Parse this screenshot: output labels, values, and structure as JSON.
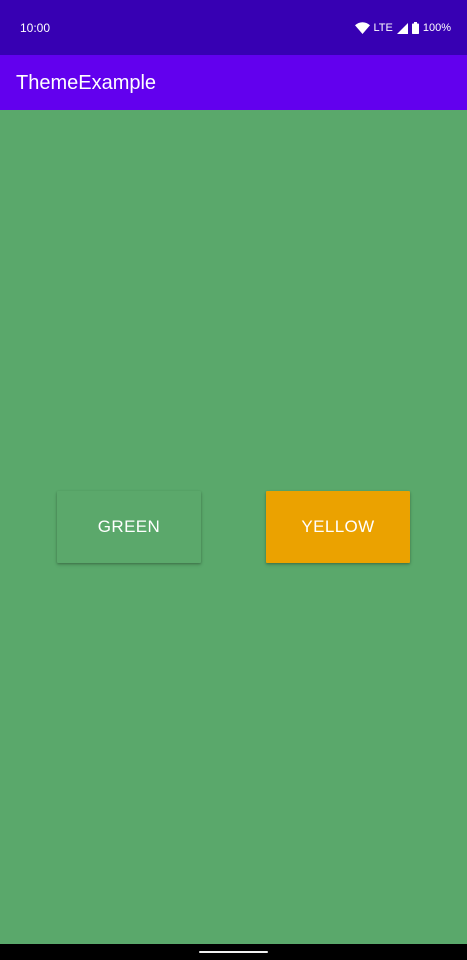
{
  "status_bar": {
    "time": "10:00",
    "network": "LTE",
    "battery": "100%",
    "icons": [
      "wifi-icon",
      "signal-icon",
      "battery-icon"
    ]
  },
  "app_bar": {
    "title": "ThemeExample"
  },
  "buttons": {
    "green": {
      "label": "GREEN",
      "color": "#5ba86b"
    },
    "yellow": {
      "label": "YELLOW",
      "color": "#eba200"
    }
  },
  "colors": {
    "status_bar": "#3700b3",
    "app_bar": "#6200ee",
    "background": "#5aa86b"
  }
}
